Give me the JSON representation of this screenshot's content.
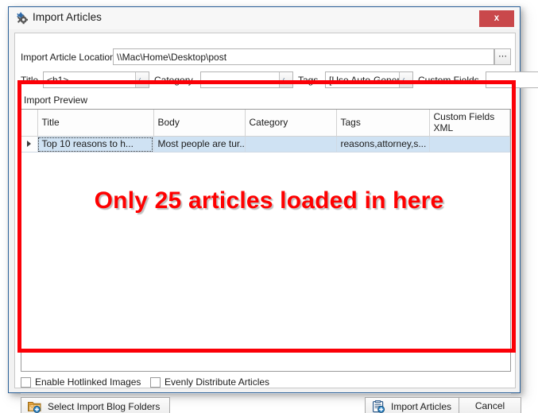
{
  "window": {
    "title": "Import Articles",
    "title_icon": "gear-icon",
    "close_label": "x",
    "accent_border": "#2a6099",
    "close_color": "#c9484b"
  },
  "form": {
    "location_label": "Import Article Location",
    "location_value": "\\\\Mac\\Home\\Desktop\\post",
    "browse_label": "⋯",
    "title_label": "Title",
    "title_value": "<h1>",
    "category_label": "Category",
    "category_value": "",
    "tags_label": "Tags",
    "tags_value": "[Use Auto-Genera",
    "custom_fields_label": "Custom Fields",
    "custom_fields_value": ""
  },
  "preview": {
    "legend": "Import Preview",
    "columns": [
      "Title",
      "Body",
      "Category",
      "Tags",
      "Custom Fields XML"
    ],
    "rows": [
      {
        "marker": "▸",
        "title": "Top 10 reasons to h...",
        "body": "Most people are tur...",
        "category": "",
        "tags": "reasons,attorney,s...",
        "custom_fields_xml": ""
      }
    ]
  },
  "annotation": {
    "text": "Only 25 articles loaded in here",
    "color": "#ff0000",
    "box_color": "#fb0007"
  },
  "options": {
    "hotlinked_label": "Enable Hotlinked Images",
    "hotlinked_checked": false,
    "evenly_label": "Evenly Distribute Articles",
    "evenly_checked": false
  },
  "buttons": {
    "select_folders": "Select Import Blog Folders",
    "select_folders_icon": "folder-add-icon",
    "import": "Import Articles",
    "import_icon": "clipboard-add-icon",
    "cancel": "Cancel"
  }
}
